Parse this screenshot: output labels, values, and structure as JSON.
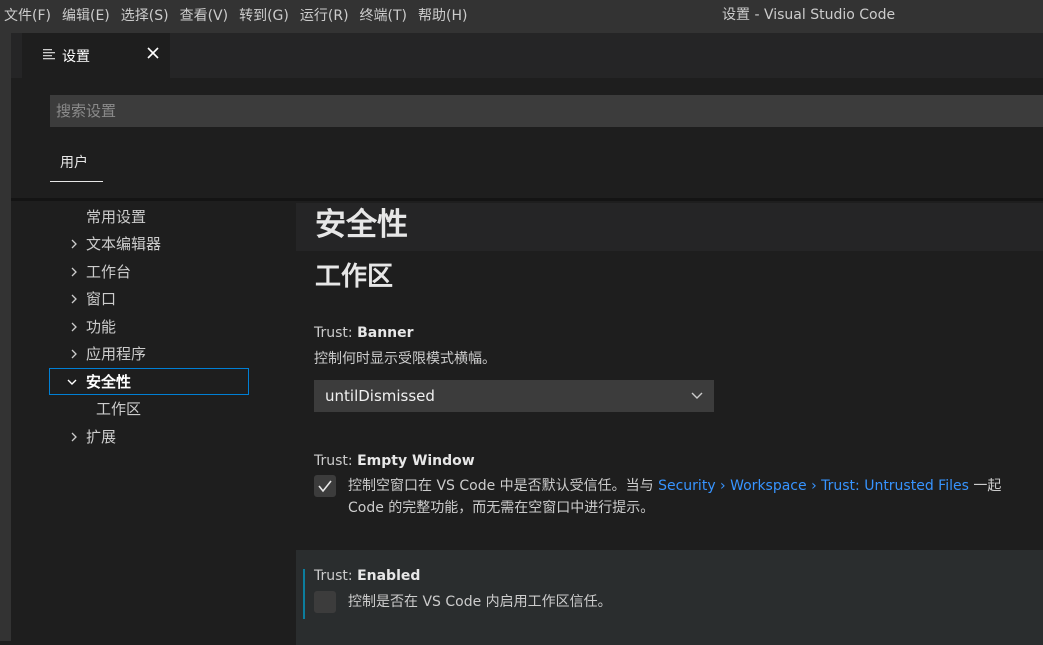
{
  "menubar": {
    "items": [
      "文件(F)",
      "编辑(E)",
      "选择(S)",
      "查看(V)",
      "转到(G)",
      "运行(R)",
      "终端(T)",
      "帮助(H)"
    ]
  },
  "window": {
    "title": "设置 - Visual Studio Code"
  },
  "tab": {
    "label": "设置",
    "icon": "settings-list-icon"
  },
  "search": {
    "placeholder": "搜索设置",
    "value": ""
  },
  "scope": {
    "user_label": "用户"
  },
  "toc": {
    "items": [
      {
        "label": "常用设置",
        "expandable": false
      },
      {
        "label": "文本编辑器",
        "expandable": true
      },
      {
        "label": "工作台",
        "expandable": true
      },
      {
        "label": "窗口",
        "expandable": true
      },
      {
        "label": "功能",
        "expandable": true
      },
      {
        "label": "应用程序",
        "expandable": true
      },
      {
        "label": "安全性",
        "expandable": true,
        "expanded": true,
        "selected": true
      },
      {
        "label": "工作区",
        "expandable": false,
        "child": true
      },
      {
        "label": "扩展",
        "expandable": true
      }
    ]
  },
  "content": {
    "group_title": "安全性",
    "section_title": "工作区",
    "settings": {
      "banner": {
        "category": "Trust: ",
        "key": "Banner",
        "description": "控制何时显示受限模式横幅。",
        "value": "untilDismissed"
      },
      "empty_window": {
        "category": "Trust: ",
        "key": "Empty Window",
        "checked": true,
        "description_line1_pre": "控制空窗口在 VS Code 中是否默认受信任。当与 ",
        "description_link": "Security › Workspace › Trust: Untrusted Files",
        "description_line1_post": " 一起",
        "description_line2": "Code 的完整功能，而无需在空窗口中进行提示。"
      },
      "enabled": {
        "category": "Trust: ",
        "key": "Enabled",
        "checked": false,
        "description": "控制是否在 VS Code 内启用工作区信任。"
      }
    }
  },
  "colors": {
    "accent_link": "#3794ff",
    "selection_border": "#007fd4",
    "modified_indicator": "#0c7d9d"
  }
}
